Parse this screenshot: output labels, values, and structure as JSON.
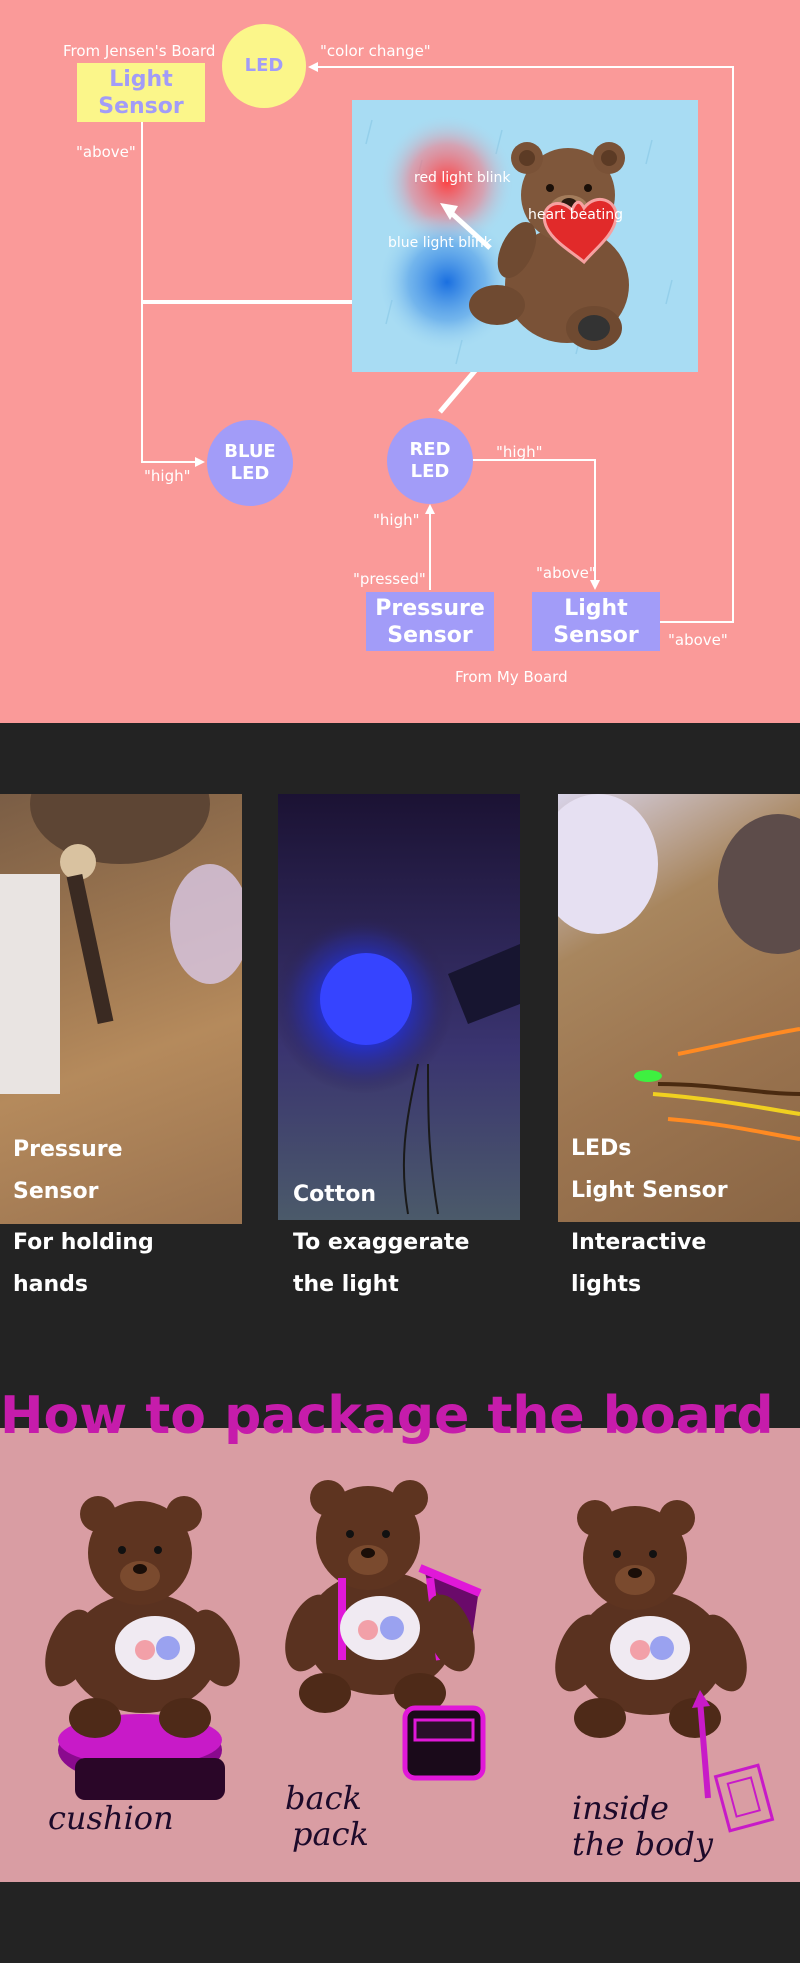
{
  "diagram": {
    "top_label": "From Jensen's Board",
    "bottom_label": "From My Board",
    "nodes": {
      "jensen_light_sensor": "Light\nSensor",
      "led": "LED",
      "blue_led": "BLUE\nLED",
      "red_led": "RED\nLED",
      "pressure_sensor": "Pressure\nSensor",
      "my_light_sensor": "Light\nSensor"
    },
    "edge_labels": {
      "color_change": "\"color change\"",
      "above_left": "\"above\"",
      "high_blue": "\"high\"",
      "high_red_right": "\"high\"",
      "high_red_below": "\"high\"",
      "pressed": "\"pressed\"",
      "above_mid": "\"above\"",
      "above_right": "\"above\""
    },
    "scene_labels": {
      "red_blink": "red light blink",
      "blue_blink": "blue light blink",
      "heart": "heart beating"
    }
  },
  "photos": [
    {
      "overlay_line1": "Pressure",
      "overlay_line2": "Sensor",
      "caption_line1": "For holding",
      "caption_line2": "hands"
    },
    {
      "overlay_line1": "Cotton",
      "overlay_line2": "",
      "caption_line1": "To exaggerate",
      "caption_line2": "the light"
    },
    {
      "overlay_line1": "LEDs",
      "overlay_line2": "Light Sensor",
      "caption_line1": "Interactive",
      "caption_line2": "lights"
    }
  ],
  "package": {
    "title": "How to package the board",
    "options": [
      {
        "line1": "cushion",
        "line2": ""
      },
      {
        "line1": "back",
        "line2": "pack"
      },
      {
        "line1": "inside",
        "line2": "the body"
      }
    ]
  },
  "colors": {
    "diagram_bg": "#fa9a99",
    "node_purple": "#a29cf8",
    "node_yellow": "#fbf68a",
    "scene_bg": "#a8dcf3",
    "page_bg": "#232323",
    "title_magenta": "#c61cab",
    "package_bg": "#d99da3"
  }
}
